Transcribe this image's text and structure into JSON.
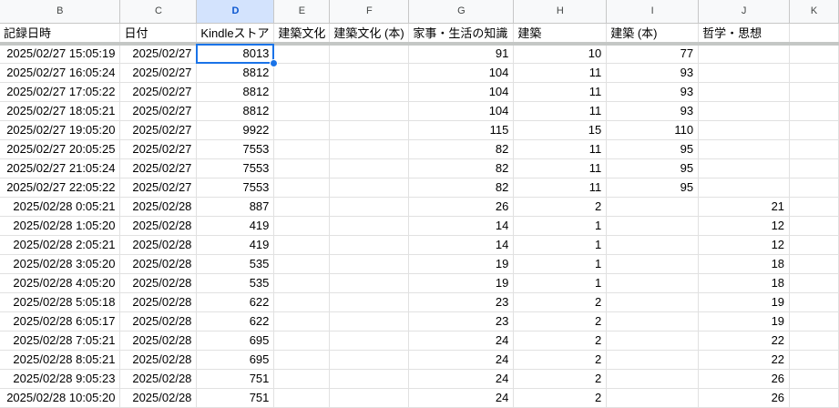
{
  "columns": [
    "B",
    "C",
    "D",
    "E",
    "F",
    "G",
    "H",
    "I",
    "J",
    "K"
  ],
  "selected_column": "D",
  "headers": [
    "記録日時",
    "日付",
    "Kindleストア",
    "建築文化",
    "建築文化 (本)",
    "家事・生活の知識",
    "建築",
    "建築 (本)",
    "哲学・思想",
    ""
  ],
  "rows": [
    [
      "2025/02/27 15:05:19",
      "2025/02/27",
      "8013",
      "",
      "",
      "91",
      "10",
      "77",
      ""
    ],
    [
      "2025/02/27 16:05:24",
      "2025/02/27",
      "8812",
      "",
      "",
      "104",
      "11",
      "93",
      ""
    ],
    [
      "2025/02/27 17:05:22",
      "2025/02/27",
      "8812",
      "",
      "",
      "104",
      "11",
      "93",
      ""
    ],
    [
      "2025/02/27 18:05:21",
      "2025/02/27",
      "8812",
      "",
      "",
      "104",
      "11",
      "93",
      ""
    ],
    [
      "2025/02/27 19:05:20",
      "2025/02/27",
      "9922",
      "",
      "",
      "115",
      "15",
      "110",
      ""
    ],
    [
      "2025/02/27 20:05:25",
      "2025/02/27",
      "7553",
      "",
      "",
      "82",
      "11",
      "95",
      ""
    ],
    [
      "2025/02/27 21:05:24",
      "2025/02/27",
      "7553",
      "",
      "",
      "82",
      "11",
      "95",
      ""
    ],
    [
      "2025/02/27 22:05:22",
      "2025/02/27",
      "7553",
      "",
      "",
      "82",
      "11",
      "95",
      ""
    ],
    [
      "2025/02/28 0:05:21",
      "2025/02/28",
      "887",
      "",
      "",
      "26",
      "2",
      "",
      "21"
    ],
    [
      "2025/02/28 1:05:20",
      "2025/02/28",
      "419",
      "",
      "",
      "14",
      "1",
      "",
      "12"
    ],
    [
      "2025/02/28 2:05:21",
      "2025/02/28",
      "419",
      "",
      "",
      "14",
      "1",
      "",
      "12"
    ],
    [
      "2025/02/28 3:05:20",
      "2025/02/28",
      "535",
      "",
      "",
      "19",
      "1",
      "",
      "18"
    ],
    [
      "2025/02/28 4:05:20",
      "2025/02/28",
      "535",
      "",
      "",
      "19",
      "1",
      "",
      "18"
    ],
    [
      "2025/02/28 5:05:18",
      "2025/02/28",
      "622",
      "",
      "",
      "23",
      "2",
      "",
      "19"
    ],
    [
      "2025/02/28 6:05:17",
      "2025/02/28",
      "622",
      "",
      "",
      "23",
      "2",
      "",
      "19"
    ],
    [
      "2025/02/28 7:05:21",
      "2025/02/28",
      "695",
      "",
      "",
      "24",
      "2",
      "",
      "22"
    ],
    [
      "2025/02/28 8:05:21",
      "2025/02/28",
      "695",
      "",
      "",
      "24",
      "2",
      "",
      "22"
    ],
    [
      "2025/02/28 9:05:23",
      "2025/02/28",
      "751",
      "",
      "",
      "24",
      "2",
      "",
      "26"
    ],
    [
      "2025/02/28 10:05:20",
      "2025/02/28",
      "751",
      "",
      "",
      "24",
      "2",
      "",
      "26"
    ]
  ],
  "colors": {
    "selection": "#1a73e8",
    "header_bg": "#f8f9fa",
    "selected_header_bg": "#d3e3fd",
    "grid": "#e1e1e1"
  }
}
